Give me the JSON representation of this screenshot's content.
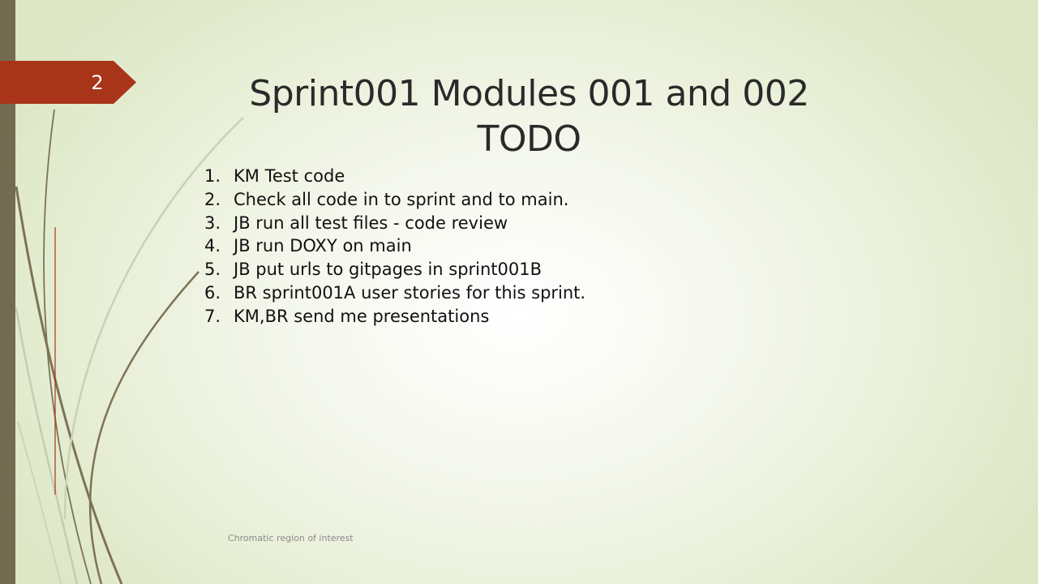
{
  "slide": {
    "number": "2",
    "title": "Sprint001 Modules 001 and 002 TODO",
    "footer": "Chromatic region of interest"
  },
  "todo": [
    {
      "num": "1.",
      "text": "KM Test code"
    },
    {
      "num": "2.",
      "text": "Check all code in to sprint and to main."
    },
    {
      "num": "3.",
      "text": "JB run all test files - code review"
    },
    {
      "num": "4.",
      "text": "JB run DOXY on main"
    },
    {
      "num": "5.",
      "text": "JB put urls to gitpages in sprint001B"
    },
    {
      "num": "6.",
      "text": "BR sprint001A user stories for this sprint."
    },
    {
      "num": "7.",
      "text": "KM,BR send me presentations"
    }
  ],
  "colors": {
    "accent": "#a8341a",
    "sidebar": "#746a4f"
  }
}
